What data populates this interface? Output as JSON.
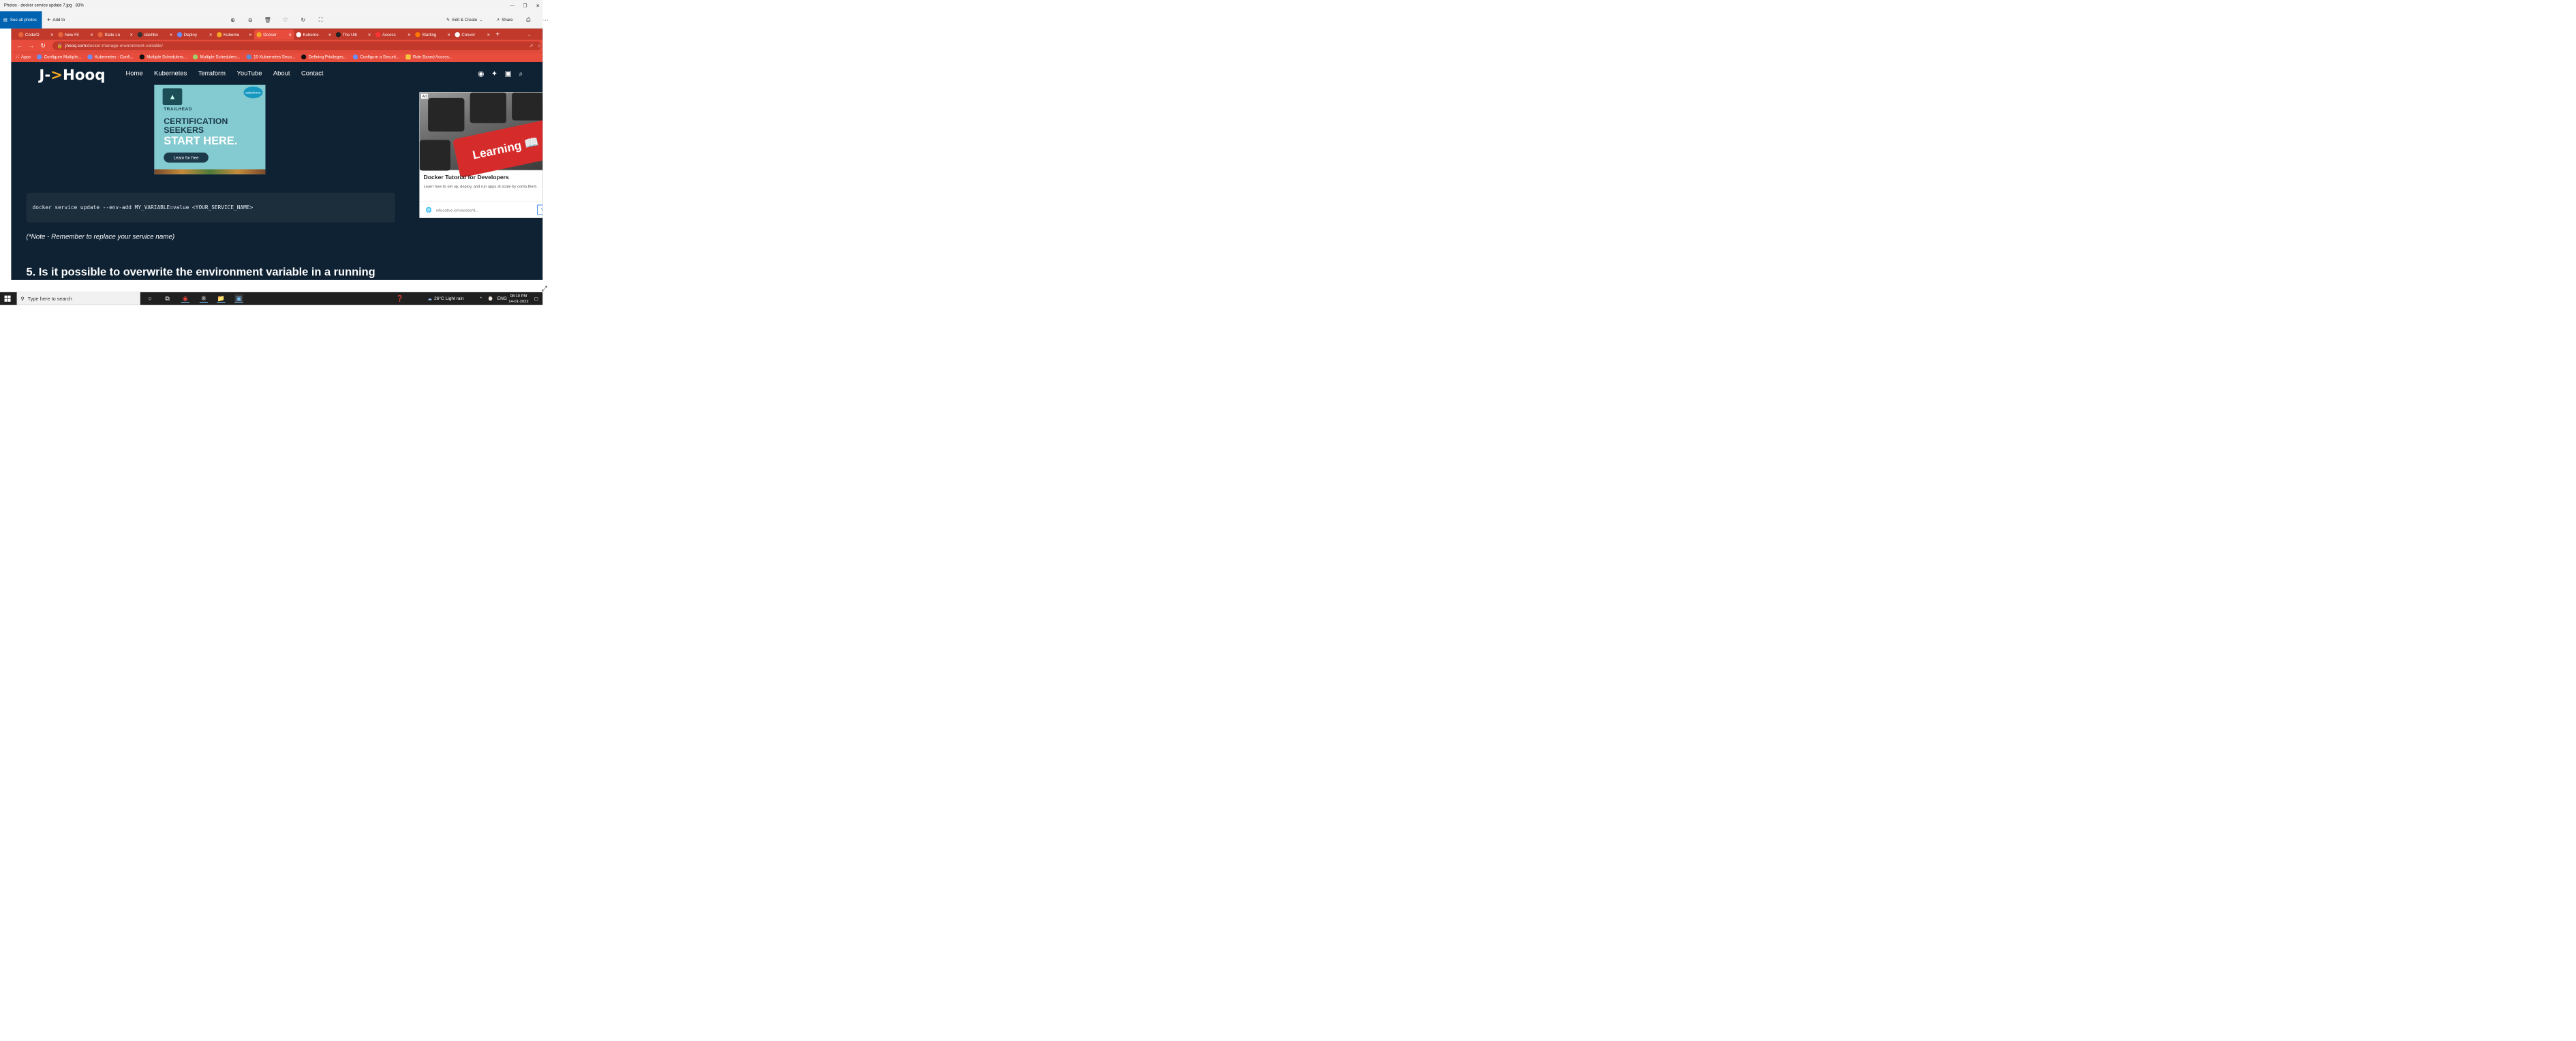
{
  "window": {
    "title": "Photos - docker service update 7.jpg",
    "zoom": "83%"
  },
  "photos_toolbar": {
    "see_all_photos": "See all photos",
    "add_to": "Add to",
    "edit_create": "Edit & Create",
    "share": "Share"
  },
  "browser": {
    "tabs": [
      {
        "label": "Code/D",
        "color": "#e8653a"
      },
      {
        "label": "New Fil",
        "color": "#e8653a"
      },
      {
        "label": "State Lo",
        "color": "#e8653a"
      },
      {
        "label": "dashbo",
        "color": "#333333"
      },
      {
        "label": "Deploy",
        "color": "#6c8ef5"
      },
      {
        "label": "Kuberne",
        "color": "#f5a623"
      },
      {
        "label": "Docker",
        "color": "#f5a623",
        "active": true
      },
      {
        "label": "Kuberne",
        "color": "#ffffff"
      },
      {
        "label": "The Ulti",
        "color": "#222222"
      },
      {
        "label": "Access",
        "color": "#ff3333"
      },
      {
        "label": "Starting",
        "color": "#ff7a00"
      },
      {
        "label": "Conver",
        "color": "#ffffff"
      }
    ],
    "url_domain": "jhooq.com",
    "url_path": "/docker-manage-environment-variable/",
    "bookmarks": [
      "Apps",
      "Configure Multiple...",
      "Kubernetes - Confi...",
      "Multiple Schedulers...",
      "Multiple Schedulers...",
      "10 Kubernetes Secu...",
      "Defining Privileges...",
      "Configure a Securit...",
      "Role Based Access..."
    ]
  },
  "site": {
    "logo_left": "J-",
    "logo_arrow": ">",
    "logo_right": "Hooq",
    "nav": [
      "Home",
      "Kubernetes",
      "Terraform",
      "YouTube",
      "About",
      "Contact"
    ]
  },
  "banner_ad": {
    "brand": "TRAILHEAD",
    "corner": "salesforce",
    "line1": "CERTIFICATION",
    "line2": "SEEKERS",
    "line3": "START HERE.",
    "cta": "Learn for free"
  },
  "content": {
    "code": "docker service update --env-add MY_VARIABLE=value <YOUR_SERVICE_NAME>",
    "note": "(*Note - Remember to replace your service name)",
    "heading": "5. Is it possible to overwrite the environment variable in a running"
  },
  "side_ad": {
    "label": "Ad",
    "key_text": "Learning",
    "title": "Docker Tutorial for Developers",
    "description": "Learn how to set up, deploy, and run apps at scale by conta them.",
    "url": "educative.io/courses/d...",
    "button": "V"
  },
  "taskbar": {
    "search_placeholder": "Type here to search",
    "weather": "26°C  Light rain",
    "language": "ENG",
    "time": "08:19 PM",
    "date": "14-01-2022"
  }
}
